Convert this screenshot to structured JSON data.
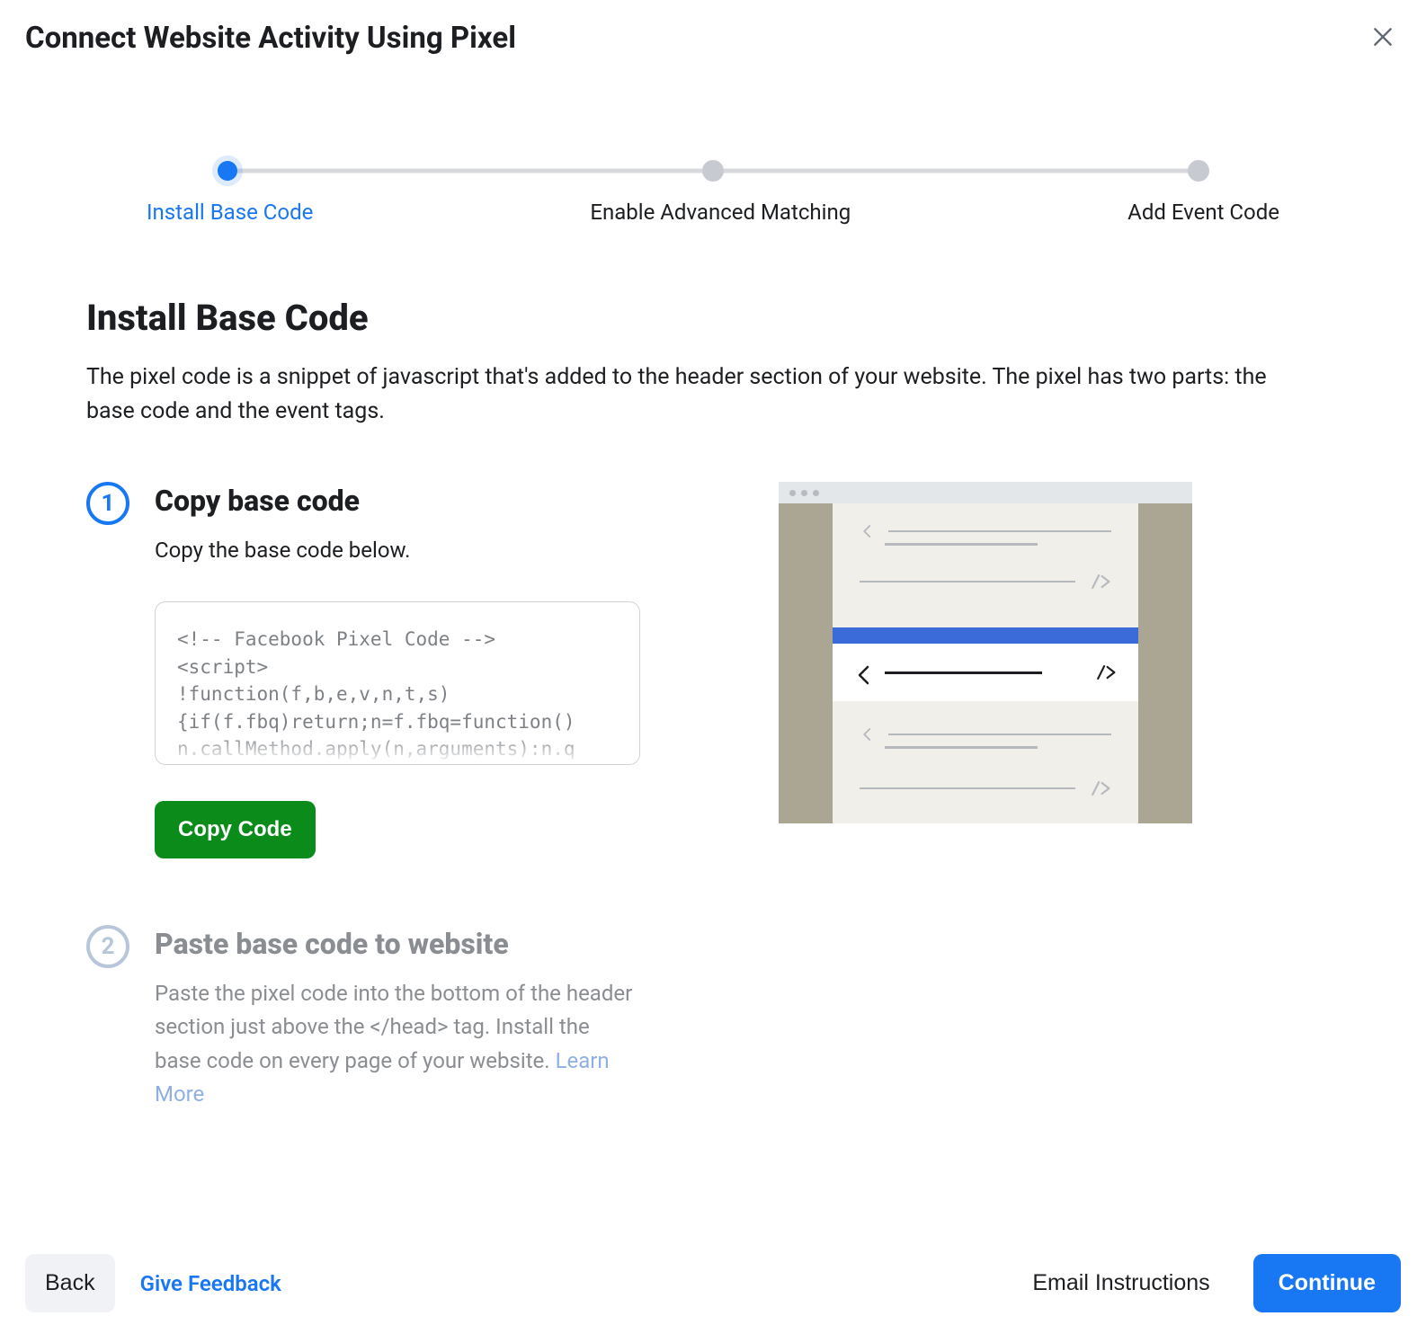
{
  "header": {
    "title": "Connect Website Activity Using Pixel"
  },
  "stepper": {
    "steps": [
      {
        "label": "Install Base Code",
        "active": true
      },
      {
        "label": "Enable Advanced Matching",
        "active": false
      },
      {
        "label": "Add Event Code",
        "active": false
      }
    ]
  },
  "main": {
    "heading": "Install Base Code",
    "description": "The pixel code is a snippet of javascript that's added to the header section of your website. The pixel has two parts: the base code and the event tags."
  },
  "steps": {
    "one": {
      "badge": "1",
      "title": "Copy base code",
      "subtitle": "Copy the base code below.",
      "code": "<!-- Facebook Pixel Code -->\n<script>\n!function(f,b,e,v,n,t,s)\n{if(f.fbq)return;n=f.fbq=function()\nn.callMethod.apply(n,arguments):n.q",
      "copy_label": "Copy Code"
    },
    "two": {
      "badge": "2",
      "title": "Paste base code to website",
      "desc_prefix": "Paste the pixel code into the bottom of the header section just above the </head> tag. Install the base code on every page of your website. ",
      "learn_more": "Learn More"
    }
  },
  "footer": {
    "back": "Back",
    "feedback": "Give Feedback",
    "email": "Email Instructions",
    "continue": "Continue"
  },
  "colors": {
    "accent_blue": "#1877f2",
    "action_green": "#0b8c1a"
  }
}
